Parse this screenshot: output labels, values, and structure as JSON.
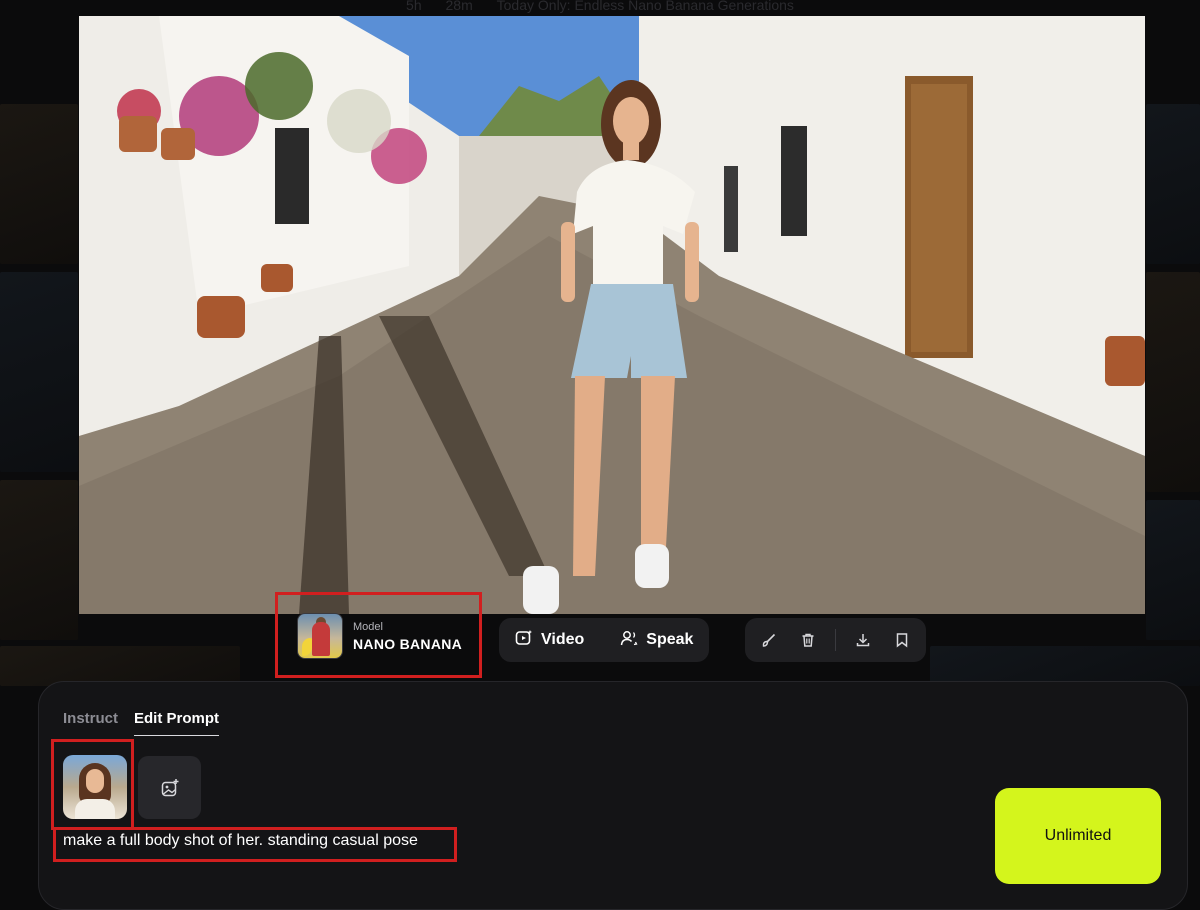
{
  "banner": {
    "hours": "5h",
    "minutes": "28m",
    "message": "Today Only: Endless Nano Banana Generations"
  },
  "model": {
    "caption": "Model",
    "name": "NANO BANANA",
    "icon": "model-avatar"
  },
  "actions": {
    "video_label": "Video",
    "video_icon": "video-spark-icon",
    "speak_label": "Speak",
    "speak_icon": "speak-user-icon"
  },
  "tools": [
    {
      "name": "brush-icon"
    },
    {
      "name": "trash-icon"
    },
    {
      "name": "download-icon"
    },
    {
      "name": "bookmark-icon"
    }
  ],
  "panel": {
    "tabs": [
      {
        "label": "Instruct",
        "active": false
      },
      {
        "label": "Edit Prompt",
        "active": true
      }
    ],
    "prompt": "make a full body shot of her. standing casual pose",
    "generate_label": "Unlimited"
  },
  "colors": {
    "accent": "#d4f51c",
    "highlight": "#d11f1f",
    "panel_bg": "#141416",
    "pill_bg": "#1f1f22"
  }
}
